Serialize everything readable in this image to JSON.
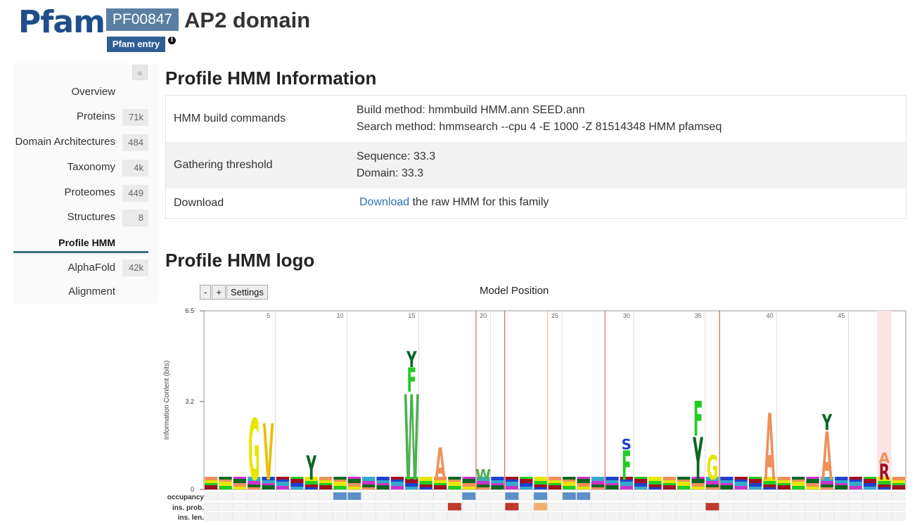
{
  "header": {
    "logo": "Pfam",
    "accession": "PF00847",
    "family_name": "AP2 domain",
    "entry_badge": "Pfam entry",
    "info_icon": "i"
  },
  "sidebar": {
    "collapse_icon": "«",
    "items": [
      {
        "label": "Overview",
        "count": ""
      },
      {
        "label": "Proteins",
        "count": "71k"
      },
      {
        "label": "Domain Architectures",
        "count": "484"
      },
      {
        "label": "Taxonomy",
        "count": "4k"
      },
      {
        "label": "Proteomes",
        "count": "449"
      },
      {
        "label": "Structures",
        "count": "8"
      },
      {
        "label": "Profile HMM",
        "count": "",
        "active": true
      },
      {
        "label": "AlphaFold",
        "count": "42k"
      },
      {
        "label": "Alignment",
        "count": ""
      }
    ]
  },
  "main": {
    "section1_title": "Profile HMM Information",
    "rows": [
      {
        "key": "HMM build commands",
        "lines": [
          "Build method: hmmbuild HMM.ann SEED.ann",
          "Search method: hmmsearch --cpu 4 -E 1000 -Z 81514348 HMM pfamseq"
        ]
      },
      {
        "key": "Gathering threshold",
        "lines": [
          "Sequence: 33.3",
          "Domain: 33.3"
        ]
      },
      {
        "key": "Download",
        "link": "Download",
        "rest": " the raw HMM for this family"
      }
    ],
    "section2_title": "Profile HMM logo"
  },
  "logo_controls": {
    "minus": "-",
    "plus": "+",
    "settings": "Settings",
    "axis_title": "Model Position"
  },
  "hmm_logo": {
    "ylabel": "Information Content (bits)",
    "y_ticks": [
      "6.5",
      "3.2",
      "0"
    ],
    "x_ticks": [
      "5",
      "10",
      "15",
      "20",
      "25",
      "30",
      "35",
      "40",
      "45"
    ],
    "row_labels": [
      "occupancy",
      "ins. prob.",
      "ins. len."
    ],
    "letters": [
      {
        "pos": 4,
        "ch": "G",
        "color": "#e6e600",
        "height": 2.3
      },
      {
        "pos": 5,
        "ch": "V",
        "color": "#e6c000",
        "height": 2.1
      },
      {
        "pos": 8,
        "ch": "Y",
        "color": "#0b6623",
        "height": 0.9
      },
      {
        "pos": 15,
        "ch": "W",
        "color": "#4caf50",
        "height": 3.2
      },
      {
        "pos": 15,
        "ch": "F",
        "color": "#22cc22",
        "height": 0.9
      },
      {
        "pos": 15,
        "ch": "Y",
        "color": "#0b6623",
        "height": 0.6
      },
      {
        "pos": 17,
        "ch": "A",
        "color": "#f0905a",
        "height": 1.2
      },
      {
        "pos": 20,
        "ch": "W",
        "color": "#4caf50",
        "height": 0.4
      },
      {
        "pos": 30,
        "ch": "F",
        "color": "#22cc22",
        "height": 1.1
      },
      {
        "pos": 30,
        "ch": "S",
        "color": "#1f3fcc",
        "height": 0.4
      },
      {
        "pos": 35,
        "ch": "Y",
        "color": "#0b6623",
        "height": 1.6
      },
      {
        "pos": 35,
        "ch": "F",
        "color": "#22cc22",
        "height": 1.3
      },
      {
        "pos": 36,
        "ch": "G",
        "color": "#e6e600",
        "height": 0.9
      },
      {
        "pos": 40,
        "ch": "A",
        "color": "#f0905a",
        "height": 2.5
      },
      {
        "pos": 44,
        "ch": "A",
        "color": "#f0905a",
        "height": 1.8
      },
      {
        "pos": 44,
        "ch": "Y",
        "color": "#0b6623",
        "height": 0.6
      },
      {
        "pos": 48,
        "ch": "R",
        "color": "#a01020",
        "height": 0.6
      },
      {
        "pos": 48,
        "ch": "A",
        "color": "#f0905a",
        "height": 0.4
      }
    ],
    "red_lines": [
      19,
      21,
      28,
      36
    ],
    "orange_lines": [
      24
    ],
    "highlight_band": 48
  }
}
